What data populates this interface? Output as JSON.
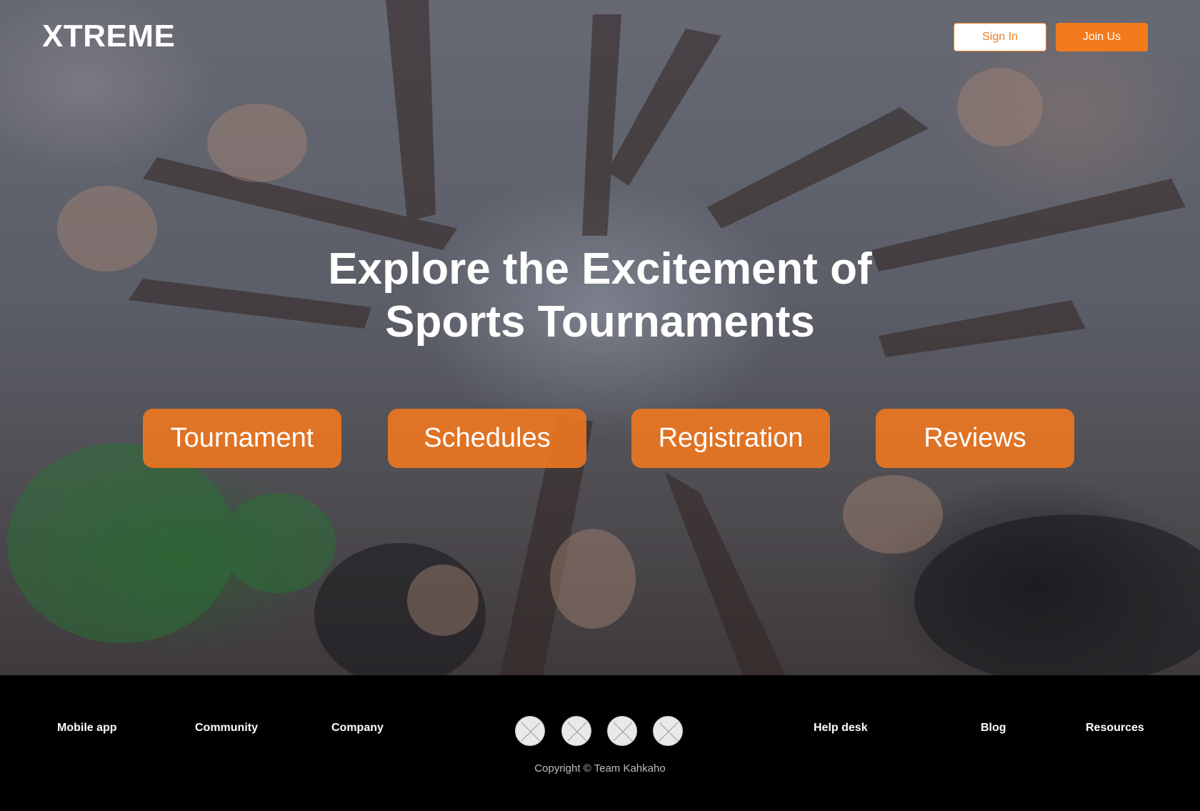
{
  "header": {
    "logo": "XTREME",
    "sign_in_label": "Sign In",
    "join_label": "Join Us"
  },
  "hero": {
    "headline_line1": "Explore the Excitement of",
    "headline_line2": "Sports Tournaments",
    "buttons": [
      "Tournament",
      "Schedules",
      "Registration",
      "Reviews"
    ]
  },
  "footer": {
    "left_links": [
      "Mobile app",
      "Community",
      "Company"
    ],
    "right_links": [
      "Help desk",
      "Blog",
      "Resources"
    ],
    "social_icons": [
      "social-icon-1",
      "social-icon-2",
      "social-icon-3",
      "social-icon-4"
    ],
    "copyright": "Copyright © Team Kahkaho"
  },
  "colors": {
    "accent": "#f37a1c",
    "footer_bg": "#000000",
    "text_light": "#ffffff"
  }
}
